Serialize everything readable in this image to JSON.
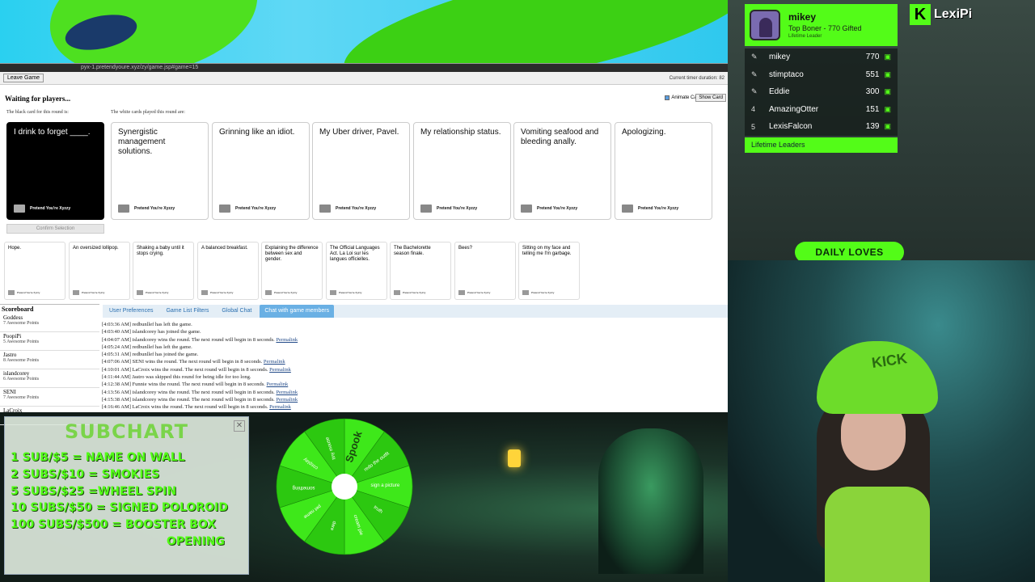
{
  "browser": {
    "url_text": "pyx-1.pretendyoure.xyz/zy/game.jsp#game=15"
  },
  "game": {
    "leave_button": "Leave Game",
    "timer_label": "Current timer duration: 82",
    "status": "Waiting for players...",
    "black_card_label": "The black card for this round is:",
    "white_card_label": "The white cards played this round are:",
    "animate_label": "Animate Cards",
    "show_card_button": "Show Card",
    "black_card": "I drink to forget ____.",
    "card_footer": "Pretend You're Xyzzy",
    "played_cards": [
      "Synergistic management solutions.",
      "Grinning like an idiot.",
      "My Uber driver, Pavel.",
      "My relationship status.",
      "Vomiting seafood and bleeding anally.",
      "Apologizing."
    ],
    "confirm_button": "Confirm Selection",
    "hand_cards": [
      "Hope.",
      "An oversized lollipop.",
      "Shaking a baby until it stops crying.",
      "A balanced breakfast.",
      "Explaining the difference between sex and gender.",
      "The Official Languages Act. La Loi sur les langues officielles.",
      "The Bachelorette season finale.",
      "Bees?",
      "Sitting on my face and telling me I'm garbage."
    ],
    "scoreboard_title": "Scoreboard",
    "scoreboard": [
      {
        "name": "Goddess",
        "points": "7 Awesome Points"
      },
      {
        "name": "PoopiPi",
        "points": "5 Awesome Points"
      },
      {
        "name": "Jastro",
        "points": "8 Awesome Points"
      },
      {
        "name": "islandcorey",
        "points": "6 Awesome Points"
      },
      {
        "name": "SENI",
        "points": "7 Awesome Points"
      },
      {
        "name": "LaCroix",
        "points": ""
      }
    ],
    "tabs": [
      "User Preferences",
      "Game List Filters",
      "Global Chat",
      "Chat with game members"
    ],
    "permalink": "Permalink",
    "chat_log": [
      {
        "text": "[4:03:36 AM] redbunllef has left the game.",
        "link": false
      },
      {
        "text": "[4:03:40 AM] islandcorey has joined the game.",
        "link": false
      },
      {
        "text": "[4:04:07 AM] islandcorey wins the round. The next round will begin in 8 seconds.",
        "link": true
      },
      {
        "text": "[4:05:24 AM] redbunllef has left the game.",
        "link": false
      },
      {
        "text": "[4:05:31 AM] redbunllef has joined the game.",
        "link": false
      },
      {
        "text": "[4:07:06 AM] SENI wins the round. The next round will begin in 8 seconds.",
        "link": true
      },
      {
        "text": "[4:10:01 AM] LaCroix wins the round. The next round will begin in 8 seconds.",
        "link": true
      },
      {
        "text": "[4:11:44 AM] Jastro was skipped this round for being idle for too long.",
        "link": false
      },
      {
        "text": "[4:12:38 AM] Funnie wins the round. The next round will begin in 8 seconds.",
        "link": true
      },
      {
        "text": "[4:13:56 AM] islandcorey wins the round. The next round will begin in 8 seconds.",
        "link": true
      },
      {
        "text": "[4:15:38 AM] islandcorey wins the round. The next round will begin in 8 seconds.",
        "link": true
      },
      {
        "text": "[4:16:46 AM] LaCroix wins the round. The next round will begin in 8 seconds.",
        "link": true
      }
    ]
  },
  "leaderboard": {
    "top_name": "mikey",
    "top_sub": "Top Boner - 770 Gifted",
    "top_tag": "Lifetime Leader",
    "rows": [
      {
        "rank": "",
        "name": "mikey",
        "score": "770"
      },
      {
        "rank": "",
        "name": "stimptaco",
        "score": "551"
      },
      {
        "rank": "",
        "name": "Eddie",
        "score": "300"
      },
      {
        "rank": "4",
        "name": "AmazingOtter",
        "score": "151"
      },
      {
        "rank": "5",
        "name": "LexisFalcon",
        "score": "139"
      }
    ],
    "footer": "Lifetime Leaders"
  },
  "kick": {
    "logo": "K",
    "channel": "LexiPi"
  },
  "daily_loves": "DAILY LOVES",
  "hat_text": "KICK",
  "subchart": {
    "title": "SUBCHART",
    "lines": [
      "1 SUB/$5 = NAME ON WALL",
      "2 SUBS/$10 = SMOKIES",
      "5 SUBS/$25 =WHEEL SPIN",
      "10 SUBS/$50 = SIGNED POLOROID",
      "100 SUBS/$500 = BOOSTER BOX",
      "OPENING"
    ]
  },
  "wheel": {
    "labels": [
      "Spook",
      "redo the outfit",
      "sign a picture",
      "truth",
      "cream pie",
      "dare",
      "pet name",
      "something",
      "cosplay",
      "tiny mouse"
    ]
  },
  "colors": {
    "kick_green": "#53fc18",
    "card_black": "#000000",
    "tab_active": "#6ab0e4"
  }
}
